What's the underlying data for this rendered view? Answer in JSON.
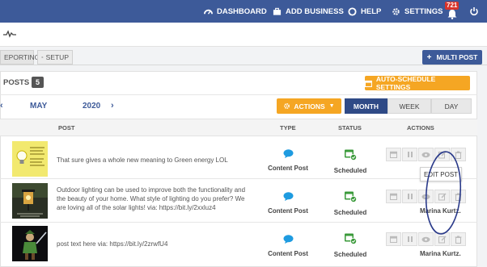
{
  "topnav": {
    "dashboard": "DASHBOARD",
    "add_business": "ADD BUSINESS",
    "help": "HELP",
    "settings": "SETTINGS",
    "notifications_count": "721"
  },
  "tabs": {
    "reporting": "EPORTING",
    "setup": "SETUP"
  },
  "toolbar": {
    "multi_post": "MULTI POST",
    "posts_label": "POSTS",
    "posts_count": "5",
    "auto_schedule": "AUTO-SCHEDULE SETTINGS"
  },
  "calendar": {
    "prev": "‹",
    "month": "MAY",
    "year": "2020",
    "next": "›",
    "actions_label": "ACTIONS",
    "views": [
      "MONTH",
      "WEEK",
      "DAY"
    ],
    "active_view": "MONTH"
  },
  "table": {
    "headers": {
      "post": "POST",
      "type": "TYPE",
      "status": "STATUS",
      "actions": "ACTIONS"
    },
    "rows": [
      {
        "text": "That sure gives a whole new meaning to Green energy LOL",
        "type": "Content Post",
        "status": "Scheduled",
        "author": "",
        "thumb": "lightbulb"
      },
      {
        "text": "Outdoor lighting can be used to improve both the functionality and the beauty of your home. What style of lighting do you prefer? We are loving all of the solar lights! via: https://bit.ly/2xxluz4",
        "type": "Content Post",
        "status": "Scheduled",
        "author": "Marina Kurtz.",
        "thumb": "lantern"
      },
      {
        "text": "post text here via: https://bit.ly/2zrwfU4",
        "type": "Content Post",
        "status": "Scheduled",
        "author": "Marina Kurtz.",
        "thumb": "warrior"
      }
    ],
    "tooltip": "EDIT POST"
  },
  "colors": {
    "nav_blue": "#3d5a99",
    "orange": "#f5a623",
    "active_view": "#2f4a86",
    "type_icon": "#1e9be0",
    "status_icon": "#3a9a3a",
    "annotation": "#2a3a8a"
  }
}
